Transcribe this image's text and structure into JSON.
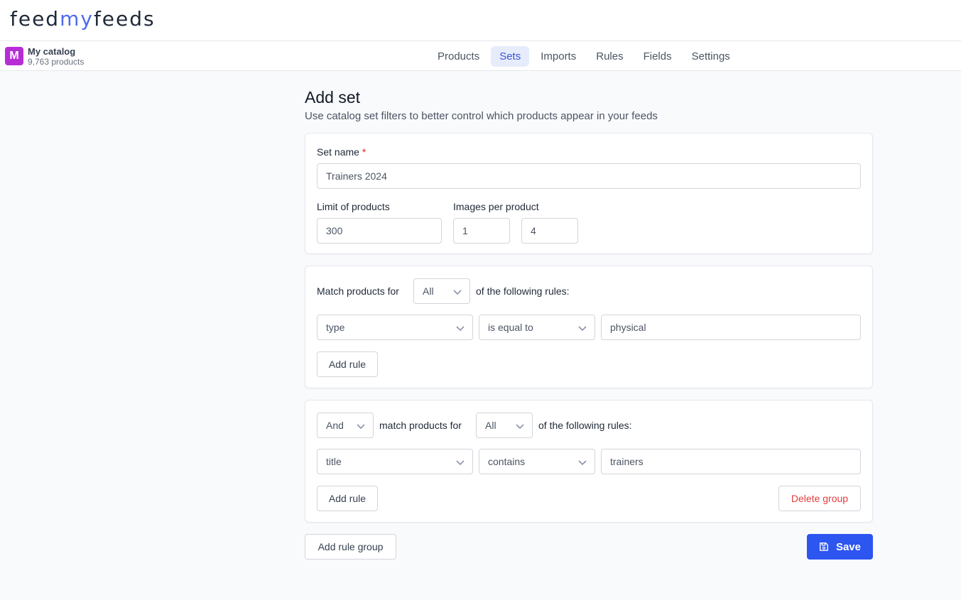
{
  "brand": {
    "logo_part1": "feed",
    "logo_part2": "my",
    "logo_part3": "feeds",
    "accent_color": "#4f6bed"
  },
  "catalog": {
    "badge": "M",
    "name": "My catalog",
    "count": "9,763 products",
    "badge_color": "#b62dd6"
  },
  "tabs": [
    {
      "label": "Products"
    },
    {
      "label": "Sets",
      "active": true
    },
    {
      "label": "Imports"
    },
    {
      "label": "Rules"
    },
    {
      "label": "Fields"
    },
    {
      "label": "Settings"
    }
  ],
  "page": {
    "title": "Add set",
    "subtitle": "Use catalog set filters to better control which products appear in your feeds"
  },
  "form": {
    "set_name_label": "Set name",
    "required_mark": "*",
    "set_name_value": "Trainers 2024",
    "limit_label": "Limit of products",
    "limit_value": "300",
    "images_label": "Images per product",
    "images_min": "1",
    "images_max": "4"
  },
  "group1": {
    "prefix": "Match products for",
    "match_mode": "All",
    "suffix": "of the following rules:",
    "rule": {
      "field": "type",
      "operator": "is equal to",
      "value": "physical"
    },
    "add_rule_label": "Add rule"
  },
  "group2": {
    "conjunction": "And",
    "prefix": "match products for",
    "match_mode": "All",
    "suffix": "of the following rules:",
    "rule": {
      "field": "title",
      "operator": "contains",
      "value": "trainers"
    },
    "add_rule_label": "Add rule",
    "delete_label": "Delete group"
  },
  "actions": {
    "add_group_label": "Add rule group",
    "save_label": "Save",
    "primary_color": "#2d55f0"
  }
}
